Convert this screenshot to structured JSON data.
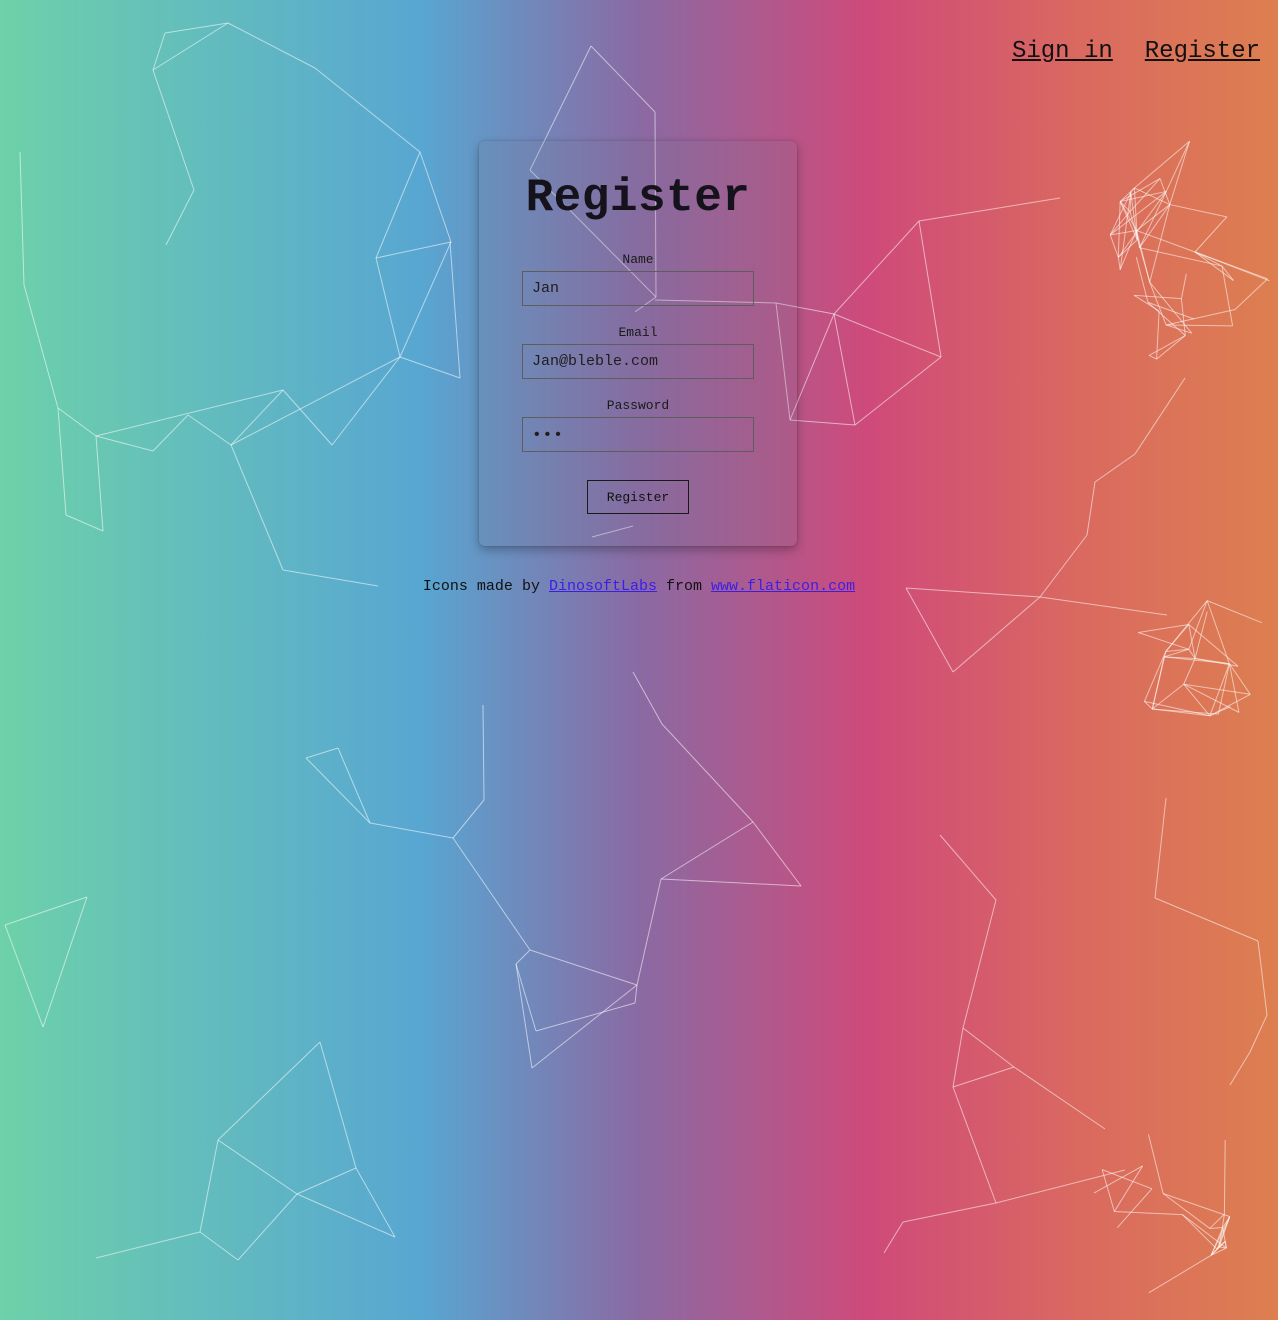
{
  "nav": {
    "sign_in": "Sign in",
    "register": "Register"
  },
  "form": {
    "title": "Register",
    "name_label": "Name",
    "name_value": "Jan",
    "email_label": "Email",
    "email_value": "Jan@bleble.com",
    "password_label": "Password",
    "password_value": "•••",
    "submit_label": "Register"
  },
  "footer": {
    "prefix": "Icons made by",
    "author_link": "DinosoftLabs",
    "middle": "from",
    "site_link": "www.flaticon.com"
  },
  "colors": {
    "gradient": [
      "#6dd1a9",
      "#58a6d2",
      "#8a6aa3",
      "#cf4a7a",
      "#dd7f50"
    ],
    "link": "#3b1ee6"
  }
}
